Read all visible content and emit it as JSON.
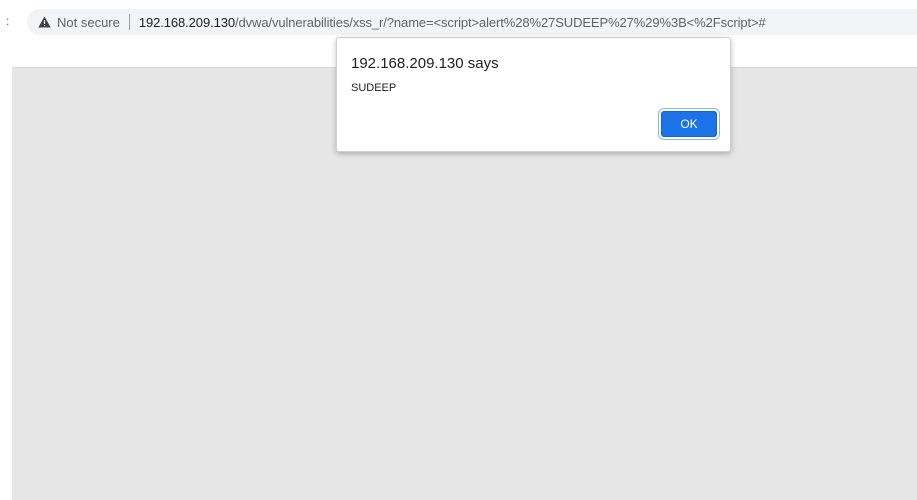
{
  "browser": {
    "left_edge_glyph": ":",
    "security_icon": "warning-triangle-icon",
    "security_text": "Not secure",
    "url_host": "192.168.209.130",
    "url_path": "/dvwa/vulnerabilities/xss_r/?name=<script>alert%28%27SUDEEP%27%29%3B<%2Fscript>#"
  },
  "dialog": {
    "title": "192.168.209.130 says",
    "message": "SUDEEP",
    "ok_label": "OK"
  },
  "colors": {
    "page_background": "#e6e6e6",
    "omnibox_background": "#f1f3f4",
    "accent": "#1a73e8"
  }
}
